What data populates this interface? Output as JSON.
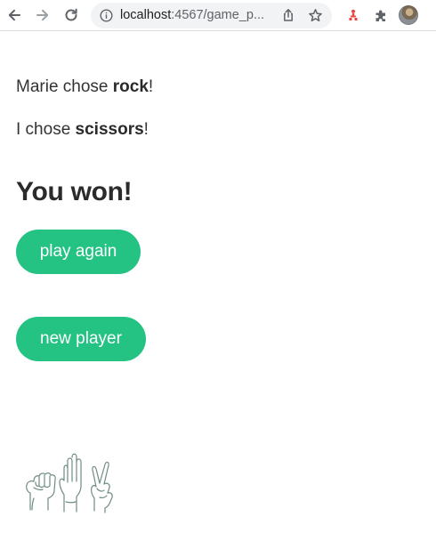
{
  "browser": {
    "url_host": "localhost",
    "url_rest": ":4567/game_p...",
    "colors": {
      "toolbar_icon": "#5f6368",
      "omnibox_bg": "#f1f3f4"
    },
    "icons": {
      "back": "arrow-left-icon",
      "forward": "arrow-right-icon",
      "reload": "reload-icon",
      "info": "info-icon",
      "share": "share-icon",
      "bookmark": "star-icon",
      "extension_1": "red-extension-icon",
      "extensions": "puzzle-icon",
      "profile": "avatar"
    }
  },
  "game": {
    "opponent_prefix": "Marie chose ",
    "opponent_choice": "rock",
    "opponent_suffix": "!",
    "player_prefix": "I chose ",
    "player_choice": "scissors",
    "player_suffix": "!",
    "result": "You won!",
    "play_again_label": "play again",
    "new_player_label": "new player",
    "illustration": "rock-paper-scissors-hands-illustration",
    "colors": {
      "button": "#24c283",
      "button_text": "#ffffff",
      "text": "#333333"
    }
  }
}
